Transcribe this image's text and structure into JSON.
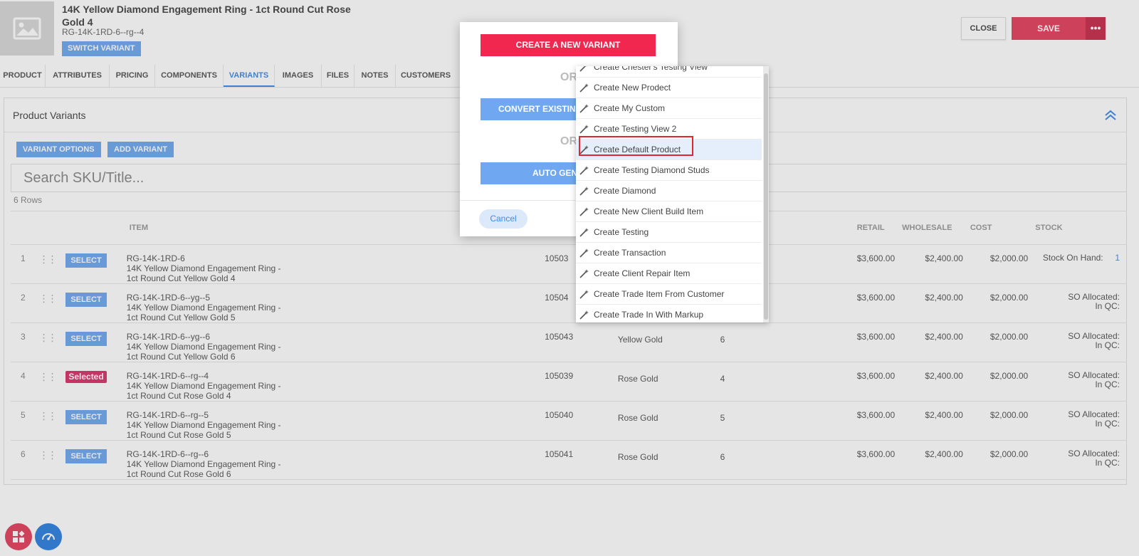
{
  "product": {
    "title": "14K Yellow Diamond Engagement Ring - 1ct Round Cut Rose Gold 4",
    "sku": "RG-14K-1RD-6--rg--4",
    "switch_variant": "SWITCH VARIANT"
  },
  "actions": {
    "close": "CLOSE",
    "save": "SAVE",
    "more": "•••"
  },
  "tabs": [
    "PRODUCT",
    "ATTRIBUTES",
    "PRICING",
    "COMPONENTS",
    "VARIANTS",
    "IMAGES",
    "FILES",
    "NOTES",
    "CUSTOMERS"
  ],
  "active_tab": "VARIANTS",
  "panel": {
    "title": "Product Variants",
    "variant_options": "VARIANT OPTIONS",
    "add_variant": "ADD VARIANT",
    "search_placeholder": "Search SKU/Title...",
    "rows_count": "6 Rows"
  },
  "table": {
    "headers": {
      "item": "ITEM",
      "retail": "RETAIL",
      "wholesale": "WHOLESALE",
      "cost": "COST",
      "stock": "STOCK"
    },
    "rows": [
      {
        "n": "1",
        "btn": "SELECT",
        "sku": "RG-14K-1RD-6",
        "name1": "14K Yellow Diamond Engagement Ring -",
        "name2": "1ct Round Cut Yellow Gold 4",
        "id": "10503",
        "metal": "",
        "size": "",
        "retail": "$3,600.00",
        "wholesale": "$2,400.00",
        "cost": "$2,000.00",
        "stock1": "Stock On Hand:",
        "stock2": "",
        "stock_val": "1"
      },
      {
        "n": "2",
        "btn": "SELECT",
        "sku": "RG-14K-1RD-6--yg--5",
        "name1": "14K Yellow Diamond Engagement Ring -",
        "name2": "1ct Round Cut Yellow Gold 5",
        "id": "10504",
        "metal": "",
        "size": "",
        "retail": "$3,600.00",
        "wholesale": "$2,400.00",
        "cost": "$2,000.00",
        "stock1": "SO Allocated:",
        "stock2": "In QC:",
        "stock_val": ""
      },
      {
        "n": "3",
        "btn": "SELECT",
        "sku": "RG-14K-1RD-6--yg--6",
        "name1": "14K Yellow Diamond Engagement Ring -",
        "name2": "1ct Round Cut Yellow Gold 6",
        "id": "105043",
        "metal": "Yellow Gold",
        "size": "6",
        "retail": "$3,600.00",
        "wholesale": "$2,400.00",
        "cost": "$2,000.00",
        "stock1": "SO Allocated:",
        "stock2": "In QC:",
        "stock_val": ""
      },
      {
        "n": "4",
        "btn": "Selected",
        "sku": "RG-14K-1RD-6--rg--4",
        "name1": "14K Yellow Diamond Engagement Ring -",
        "name2": "1ct Round Cut Rose Gold 4",
        "id": "105039",
        "metal": "Rose Gold",
        "size": "4",
        "retail": "$3,600.00",
        "wholesale": "$2,400.00",
        "cost": "$2,000.00",
        "stock1": "SO Allocated:",
        "stock2": "In QC:",
        "stock_val": ""
      },
      {
        "n": "5",
        "btn": "SELECT",
        "sku": "RG-14K-1RD-6--rg--5",
        "name1": "14K Yellow Diamond Engagement Ring -",
        "name2": "1ct Round Cut Rose Gold 5",
        "id": "105040",
        "metal": "Rose Gold",
        "size": "5",
        "retail": "$3,600.00",
        "wholesale": "$2,400.00",
        "cost": "$2,000.00",
        "stock1": "SO Allocated:",
        "stock2": "In QC:",
        "stock_val": ""
      },
      {
        "n": "6",
        "btn": "SELECT",
        "sku": "RG-14K-1RD-6--rg--6",
        "name1": "14K Yellow Diamond Engagement Ring -",
        "name2": "1ct Round Cut Rose Gold 6",
        "id": "105041",
        "metal": "Rose Gold",
        "size": "6",
        "retail": "$3,600.00",
        "wholesale": "$2,400.00",
        "cost": "$2,000.00",
        "stock1": "SO Allocated:",
        "stock2": "In QC:",
        "stock_val": ""
      }
    ]
  },
  "modal": {
    "create_new": "CREATE A NEW VARIANT",
    "or1": "OR",
    "convert": "CONVERT EXISTIN",
    "or2": "OR",
    "auto": "AUTO GEN",
    "cancel": "Cancel"
  },
  "dropdown": {
    "items": [
      "Create Chester's Testing View",
      "Create New Prodect",
      "Create My Custom",
      "Create Testing View 2",
      "Create Default Product",
      "Create Testing Diamond Studs",
      "Create Diamond",
      "Create New Client Build Item",
      "Create Testing",
      "Create Transaction",
      "Create Client Repair Item",
      "Create Trade Item From Customer",
      "Create Trade In With Markup"
    ],
    "highlighted": "Create Default Product"
  },
  "colors": {
    "accent": "#3f8be6",
    "primary_button": "#6fa8f0",
    "save": "#e4415f",
    "create_new": "#f2274f",
    "selected_badge": "#d8336b",
    "highlight_box": "#e0262e"
  },
  "icons": {
    "thumb": "image-placeholder-icon",
    "collapse": "double-chevron-up-icon",
    "drag": "drag-handle-icon",
    "wand": "magic-wand-icon",
    "fab1": "grid-apps-icon",
    "fab2": "speedometer-icon"
  }
}
